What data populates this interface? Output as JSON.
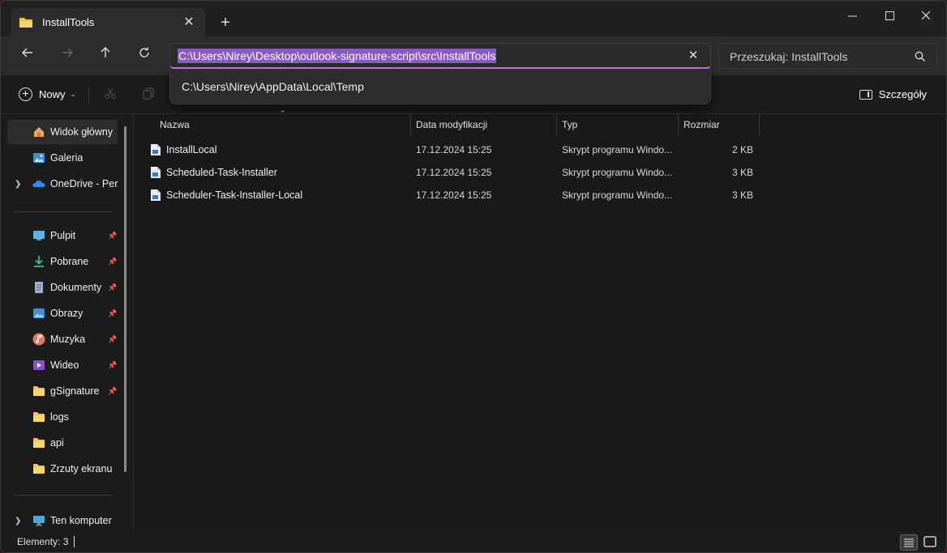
{
  "tab": {
    "title": "InstallTools"
  },
  "address": {
    "path": "C:\\Users\\Nirey\\Desktop\\outlook-signature-script\\src\\InstallTools",
    "suggestion": "C:\\Users\\Nirey\\AppData\\Local\\Temp"
  },
  "search": {
    "placeholder": "Przeszukaj: InstallTools"
  },
  "toolbar": {
    "new_label": "Nowy",
    "details_label": "Szczegóły"
  },
  "sidebar": {
    "items": [
      {
        "label": "Widok główny",
        "icon": "home-icon"
      },
      {
        "label": "Galeria",
        "icon": "gallery-icon"
      },
      {
        "label": "OneDrive - Personal",
        "icon": "onedrive-icon"
      },
      {
        "label": "Pulpit",
        "icon": "desktop-icon",
        "pinned": true
      },
      {
        "label": "Pobrane",
        "icon": "download-icon",
        "pinned": true
      },
      {
        "label": "Dokumenty",
        "icon": "documents-icon",
        "pinned": true
      },
      {
        "label": "Obrazy",
        "icon": "pictures-icon",
        "pinned": true
      },
      {
        "label": "Muzyka",
        "icon": "music-icon",
        "pinned": true
      },
      {
        "label": "Wideo",
        "icon": "video-icon",
        "pinned": true
      },
      {
        "label": "gSignature",
        "icon": "folder-icon",
        "pinned": true
      },
      {
        "label": "logs",
        "icon": "folder-icon"
      },
      {
        "label": "api",
        "icon": "folder-icon"
      },
      {
        "label": "Zrzuty ekranu",
        "icon": "folder-icon"
      },
      {
        "label": "Ten komputer",
        "icon": "computer-icon"
      }
    ]
  },
  "columns": {
    "name": "Nazwa",
    "date": "Data modyfikacji",
    "type": "Typ",
    "size": "Rozmiar"
  },
  "files": [
    {
      "name": "InstallLocal",
      "date": "17.12.2024 15:25",
      "type": "Skrypt programu Windo...",
      "size": "2 KB"
    },
    {
      "name": "Scheduled-Task-Installer",
      "date": "17.12.2024 15:25",
      "type": "Skrypt programu Windo...",
      "size": "3 KB"
    },
    {
      "name": "Scheduler-Task-Installer-Local",
      "date": "17.12.2024 15:25",
      "type": "Skrypt programu Windo...",
      "size": "3 KB"
    }
  ],
  "status": {
    "count": "Elementy: 3"
  },
  "colors": {
    "accent": "#c874e0",
    "selection": "#8a5bc4",
    "folder": "#f2c14e"
  }
}
